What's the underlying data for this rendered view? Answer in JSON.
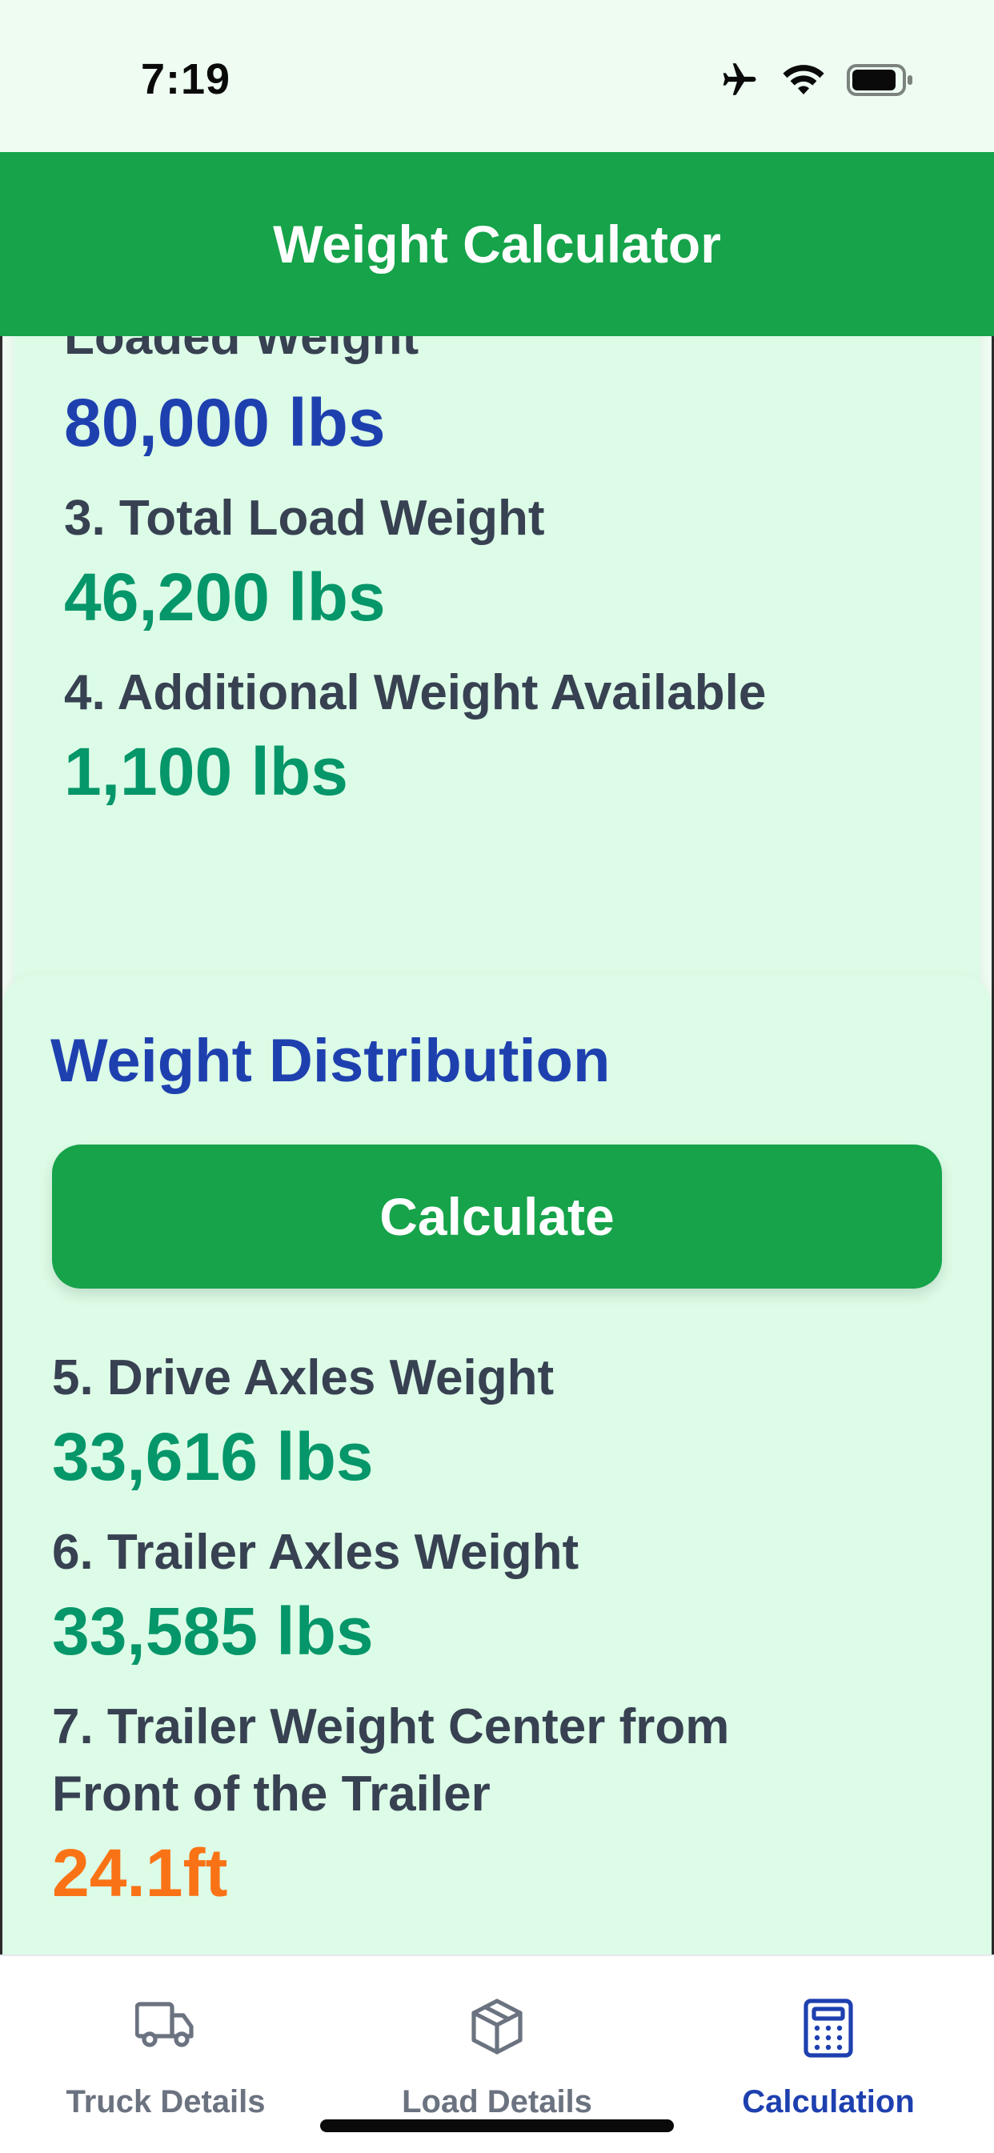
{
  "status_bar": {
    "time": "7:19"
  },
  "header": {
    "title": "Weight Calculator"
  },
  "summary": {
    "items": [
      {
        "label": "Loaded Weight",
        "value": "80,000 lbs"
      },
      {
        "label": "3. Total Load Weight",
        "value": "46,200 lbs"
      },
      {
        "label": "4. Additional Weight Available",
        "value": "1,100 lbs"
      }
    ]
  },
  "distribution": {
    "title": "Weight Distribution",
    "button_label": "Calculate",
    "items": [
      {
        "label": "5. Drive Axles Weight",
        "value": "33,616 lbs"
      },
      {
        "label": "6. Trailer Axles Weight",
        "value": "33,585 lbs"
      },
      {
        "label_line1": "7. Trailer Weight Center from",
        "label_line2": "Front of the Trailer",
        "value": "24.1ft"
      }
    ]
  },
  "tabs": [
    {
      "label": "Truck Details",
      "icon": "truck-icon",
      "active": false
    },
    {
      "label": "Load Details",
      "icon": "box-icon",
      "active": false
    },
    {
      "label": "Calculation",
      "icon": "calculator-icon",
      "active": true
    }
  ],
  "colors": {
    "header_green": "#16a34a",
    "card_bg": "#dcfce7",
    "accent_blue": "#1e40af",
    "value_green": "#059669",
    "value_orange": "#f97316"
  }
}
